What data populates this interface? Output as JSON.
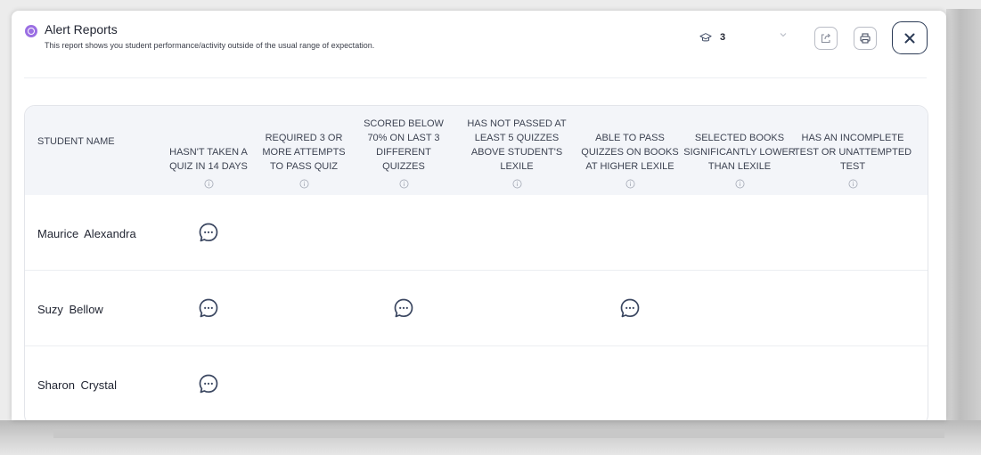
{
  "header": {
    "title": "Alert Reports",
    "subtitle": "This report shows you student performance/activity outside of the usual range of expectation.",
    "grade_value": "3",
    "icons": {
      "report": "alert-report-icon",
      "grade": "graduation-cap-icon",
      "dropdown": "chevron-down-icon",
      "export": "export-icon",
      "print": "print-icon",
      "close": "close-icon"
    }
  },
  "colors": {
    "accent": "#9b6fe3",
    "close_border": "#2b3a55",
    "header_bg": "#f3f5f9",
    "icon_stroke": "#3a4660"
  },
  "table": {
    "name_column": "STUDENT NAME",
    "columns": [
      {
        "label": "HASN'T TAKEN A QUIZ IN 14 DAYS"
      },
      {
        "label": "REQUIRED 3 OR MORE ATTEMPTS TO PASS QUIZ"
      },
      {
        "label": "SCORED BELOW 70% ON LAST 3 DIFFERENT QUIZZES"
      },
      {
        "label": "HAS NOT PASSED AT LEAST 5 QUIZZES ABOVE STUDENT'S LEXILE"
      },
      {
        "label": "ABLE TO PASS QUIZZES ON BOOKS AT HIGHER LEXILE"
      },
      {
        "label": "SELECTED BOOKS SIGNIFICANTLY LOWER THAN LEXILE"
      },
      {
        "label": "HAS AN INCOMPLETE TEST OR UNATTEMPTED TEST"
      }
    ],
    "rows": [
      {
        "name": "Maurice  Alexandra",
        "alerts": [
          true,
          false,
          false,
          false,
          false,
          false,
          false
        ]
      },
      {
        "name": "Suzy  Bellow",
        "alerts": [
          true,
          false,
          true,
          false,
          true,
          false,
          false
        ]
      },
      {
        "name": "Sharon  Crystal",
        "alerts": [
          true,
          false,
          false,
          false,
          false,
          false,
          false
        ]
      }
    ]
  }
}
